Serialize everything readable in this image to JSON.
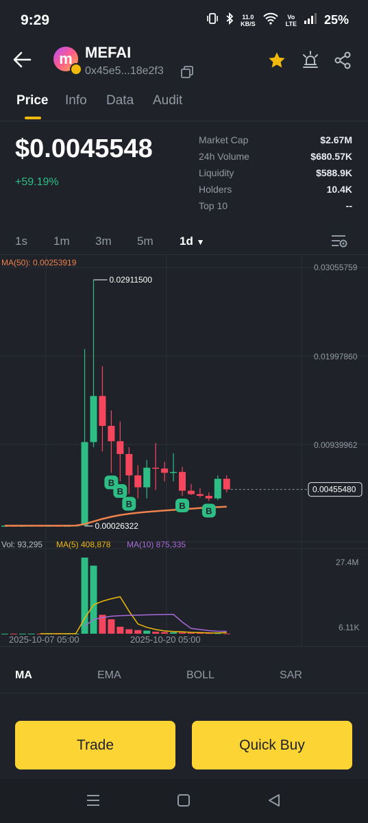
{
  "status": {
    "time": "9:29",
    "speed_top": "11.0",
    "speed_unit": "KB/S",
    "volte_top": "Vo",
    "volte_bottom": "LTE",
    "battery": "25%"
  },
  "header": {
    "token_name": "MEFAI",
    "address": "0x45e5...18e2f3",
    "logo_letter": "m"
  },
  "tabs": [
    "Price",
    "Info",
    "Data",
    "Audit"
  ],
  "summary": {
    "price": "$0.0045548",
    "change": "+59.19%",
    "stats": [
      {
        "label": "Market Cap",
        "value": "$2.67M"
      },
      {
        "label": "24h Volume",
        "value": "$680.57K"
      },
      {
        "label": "Liquidity",
        "value": "$588.9K"
      },
      {
        "label": "Holders",
        "value": "10.4K"
      },
      {
        "label": "Top 10",
        "value": "--"
      }
    ]
  },
  "intervals": [
    "1s",
    "1m",
    "3m",
    "5m",
    "1d"
  ],
  "chart": {
    "ma_label": "MA(50): 0.00253919",
    "y_ticks": [
      "0.03055759",
      "0.01997860",
      "0.00939962"
    ],
    "current_price_tag": "0.00455480",
    "high_label": "0.02911500",
    "low_label": "0.00026322",
    "vol_label": "Vol: 93,295",
    "ma5_label": "MA(5) 408,878",
    "ma10_label": "MA(10) 875,335",
    "vol_ticks": [
      "27.4M",
      "6.11K"
    ],
    "x_ticks": [
      "2025-10-07 05:00",
      "2025-10-20 05:00"
    ],
    "buy_marker": "B"
  },
  "chart_data": {
    "type": "candlestick",
    "price_range": [
      0.00026322,
      0.03055759
    ],
    "candles": [
      {
        "o": 0.0003,
        "h": 0.00035,
        "l": 0.00028,
        "c": 0.00031
      },
      {
        "o": 0.00031,
        "h": 0.00033,
        "l": 0.00027,
        "c": 0.00029
      },
      {
        "o": 0.00029,
        "h": 0.00032,
        "l": 0.00026322,
        "c": 0.0003
      },
      {
        "o": 0.0003,
        "h": 0.00034,
        "l": 0.00028,
        "c": 0.00032
      },
      {
        "o": 0.00032,
        "h": 0.00036,
        "l": 0.00029,
        "c": 0.0003
      },
      {
        "o": 0.0003,
        "h": 0.00034,
        "l": 0.00028,
        "c": 0.00031
      },
      {
        "o": 0.00031,
        "h": 0.00033,
        "l": 0.00027,
        "c": 0.00029
      },
      {
        "o": 0.00029,
        "h": 0.00032,
        "l": 0.00026322,
        "c": 0.0003
      },
      {
        "o": 0.0003,
        "h": 0.0004,
        "l": 0.00028,
        "c": 0.00035
      },
      {
        "o": 0.00035,
        "h": 0.021,
        "l": 0.0003,
        "c": 0.0101
      },
      {
        "o": 0.0101,
        "h": 0.029115,
        "l": 0.0095,
        "c": 0.0155
      },
      {
        "o": 0.0155,
        "h": 0.019,
        "l": 0.009,
        "c": 0.012
      },
      {
        "o": 0.012,
        "h": 0.0138,
        "l": 0.0065,
        "c": 0.0102
      },
      {
        "o": 0.0102,
        "h": 0.0125,
        "l": 0.0055,
        "c": 0.0087
      },
      {
        "o": 0.0087,
        "h": 0.0095,
        "l": 0.004,
        "c": 0.0062
      },
      {
        "o": 0.0062,
        "h": 0.0074,
        "l": 0.0035,
        "c": 0.0048
      },
      {
        "o": 0.0048,
        "h": 0.008,
        "l": 0.0035,
        "c": 0.0071
      },
      {
        "o": 0.0071,
        "h": 0.01,
        "l": 0.0045,
        "c": 0.007
      },
      {
        "o": 0.007,
        "h": 0.0078,
        "l": 0.0055,
        "c": 0.0065
      },
      {
        "o": 0.0065,
        "h": 0.0088,
        "l": 0.0055,
        "c": 0.0066
      },
      {
        "o": 0.0066,
        "h": 0.0072,
        "l": 0.0038,
        "c": 0.0044
      },
      {
        "o": 0.0044,
        "h": 0.0052,
        "l": 0.0039,
        "c": 0.004
      },
      {
        "o": 0.004,
        "h": 0.0047,
        "l": 0.0036,
        "c": 0.0038
      },
      {
        "o": 0.0038,
        "h": 0.0042,
        "l": 0.0032,
        "c": 0.0035
      },
      {
        "o": 0.0035,
        "h": 0.0062,
        "l": 0.0033,
        "c": 0.0058
      },
      {
        "o": 0.0058,
        "h": 0.0062,
        "l": 0.0042,
        "c": 0.0045548
      }
    ],
    "buy_markers": [
      {
        "candle": 12
      },
      {
        "candle": 13
      },
      {
        "candle": 14
      },
      {
        "candle": 20
      },
      {
        "candle": 23
      }
    ],
    "volume_range": [
      0,
      27400000
    ],
    "volume": [
      6110,
      6110,
      6110,
      6110,
      6110,
      6110,
      6110,
      6110,
      20000,
      27400000,
      24500000,
      6800000,
      5200000,
      2500000,
      1600000,
      1300000,
      1100000,
      700000,
      600000,
      500000,
      400000,
      300000,
      250000,
      200000,
      180000,
      93295
    ],
    "ma50": [
      0.0003,
      0.0003,
      0.0003,
      0.0003,
      0.0003,
      0.0003,
      0.0003,
      0.0003,
      0.00031,
      0.0005,
      0.0008,
      0.0011,
      0.00135,
      0.00155,
      0.0017,
      0.00182,
      0.00192,
      0.002,
      0.00208,
      0.00215,
      0.00222,
      0.0023,
      0.00237,
      0.00243,
      0.00248,
      0.00253919
    ],
    "ma5_volume": [
      null,
      null,
      null,
      null,
      6110,
      6110,
      6110,
      6110,
      10000,
      5500000,
      10400000,
      11700000,
      12600000,
      13300000,
      8100000,
      3500000,
      2300000,
      1500000,
      1000000,
      800000,
      700000,
      500000,
      400000,
      300000,
      260000,
      408878
    ],
    "ma10_volume": [
      null,
      null,
      null,
      null,
      null,
      null,
      null,
      null,
      null,
      2700000,
      5100000,
      5800000,
      6300000,
      6500000,
      6600000,
      6700000,
      6800000,
      6850000,
      6900000,
      6950000,
      4200000,
      1900000,
      1500000,
      1100000,
      900000,
      875335
    ]
  },
  "indicators": [
    "MA",
    "EMA",
    "BOLL",
    "SAR"
  ],
  "actions": {
    "trade": "Trade",
    "quick_buy": "Quick Buy"
  },
  "colors": {
    "up": "#2ebd85",
    "down": "#f6465d",
    "accent": "#fcd535",
    "ma50": "#f0824c",
    "ma5": "#f0b90b",
    "ma10": "#a86bd9"
  }
}
